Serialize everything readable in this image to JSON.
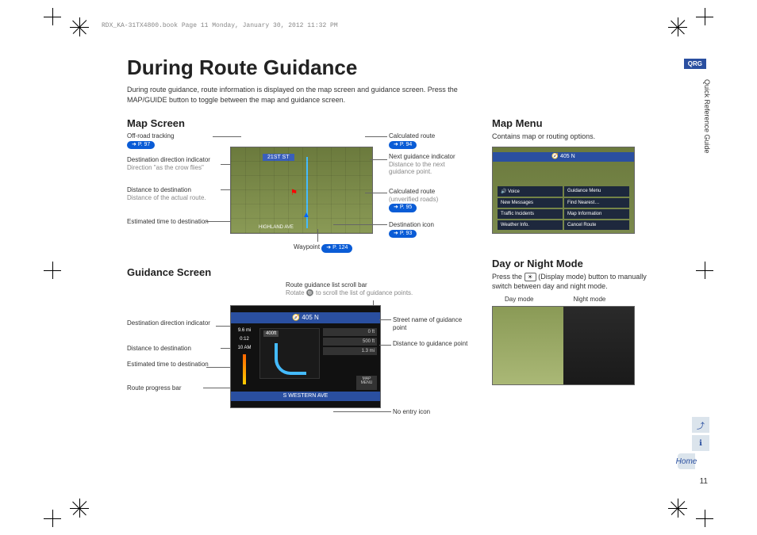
{
  "meta": {
    "header_line": "RDX_KA-31TX4800.book  Page 11  Monday, January 30, 2012  11:32 PM"
  },
  "title": "During Route Guidance",
  "intro": "During route guidance, route information is displayed on the map screen and guidance screen. Press the MAP/GUIDE button to toggle between the map and guidance screen.",
  "sections": {
    "map_screen": "Map Screen",
    "guidance_screen": "Guidance Screen",
    "map_menu": "Map Menu",
    "day_night": "Day or Night Mode"
  },
  "map_callouts": {
    "off_road": {
      "label": "Off-road tracking",
      "ref": "P. 97"
    },
    "dir_ind": {
      "label": "Destination direction indicator",
      "sub": "Direction \"as the crow flies\""
    },
    "dist": {
      "label": "Distance to destination",
      "sub": "Distance of the actual route."
    },
    "eta": {
      "label": "Estimated time to destination"
    },
    "waypoint": {
      "label": "Waypoint",
      "ref": "P. 124"
    },
    "calc_route": {
      "label": "Calculated route",
      "ref": "P. 94"
    },
    "next_guid": {
      "label": "Next guidance indicator",
      "sub": "Distance to the next guidance point."
    },
    "calc_unver": {
      "label": "Calculated route",
      "sub": "(unverified roads)",
      "ref": "P. 95"
    },
    "dest_icon": {
      "label": "Destination icon",
      "ref": "P. 93"
    }
  },
  "map_shot": {
    "top_street": "21ST ST",
    "bottom_street": "HIGHLAND AVE"
  },
  "guidance": {
    "scroll_label": "Route guidance list scroll bar",
    "scroll_sub": "Rotate 🔘 to scroll the list of guidance points.",
    "left": {
      "dir_ind": "Destination direction indicator",
      "dist": "Distance to destination",
      "eta": "Estimated time to destination",
      "progress": "Route progress bar"
    },
    "right": {
      "street": "Street name of guidance point",
      "dist": "Distance to guidance point",
      "noentry": "No entry icon"
    },
    "shot": {
      "topbar": "🧭 405 N",
      "thumb_dist": "400ft",
      "list": [
        "0 ft",
        "500 ft",
        "1.3 mi"
      ],
      "bottombar": "S WESTERN AVE",
      "map_menu": "MAP MENU",
      "stats": [
        "9.6 mi",
        "0:12",
        "10 AM"
      ]
    }
  },
  "map_menu": {
    "desc": "Contains map or routing options.",
    "topbar": "🧭 405 N",
    "items": [
      "🔊  Voice",
      "Guidance Menu",
      "New Messages",
      "Find Nearest…",
      "Traffic Incidents",
      "Map Information",
      "Weather Info.",
      "Cancel Route"
    ]
  },
  "day_night": {
    "desc1": "Press the ",
    "desc_btn": "☀",
    "desc2": " (Display mode) button to manually switch between day and night mode.",
    "day_label": "Day mode",
    "night_label": "Night mode"
  },
  "sidebar": {
    "qrg": "QRG",
    "vtext": "Quick Reference Guide",
    "home": "Home"
  },
  "page_num": "11"
}
